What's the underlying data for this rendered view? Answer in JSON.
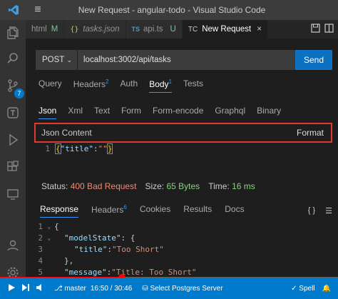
{
  "window": {
    "title": "New Request - angular-todo - Visual Studio Code"
  },
  "activity": {
    "source_control_badge": "7"
  },
  "tabs": [
    {
      "label": "html",
      "modifier": "M"
    },
    {
      "label": "tasks.json"
    },
    {
      "label": "api.ts",
      "modifier": "U"
    },
    {
      "label": "New Request",
      "close": "×"
    }
  ],
  "request": {
    "method": "POST",
    "url": "localhost:3002/api/tasks",
    "send_label": "Send",
    "tabs": [
      {
        "label": "Query"
      },
      {
        "label": "Headers",
        "count": "2"
      },
      {
        "label": "Auth"
      },
      {
        "label": "Body",
        "count": "1",
        "active": true
      },
      {
        "label": "Tests"
      }
    ],
    "body_types": [
      "Json",
      "Xml",
      "Text",
      "Form",
      "Form-encode",
      "Graphql",
      "Binary"
    ],
    "json_content_label": "Json Content",
    "format_label": "Format",
    "editor": {
      "line": "1",
      "key": "\"title\"",
      "value": "\"\""
    }
  },
  "response": {
    "status_label": "Status:",
    "status_value": "400 Bad Request",
    "size_label": "Size:",
    "size_value": "65 Bytes",
    "time_label": "Time:",
    "time_value": "16 ms",
    "tabs": [
      {
        "label": "Response",
        "active": true
      },
      {
        "label": "Headers",
        "count": "6"
      },
      {
        "label": "Cookies"
      },
      {
        "label": "Results"
      },
      {
        "label": "Docs"
      }
    ],
    "actions": [
      "{ }",
      "☰"
    ],
    "lines": [
      {
        "n": "1",
        "text": "{"
      },
      {
        "n": "2",
        "key": "\"modelState\"",
        "rest": ": {"
      },
      {
        "n": "3",
        "key": "\"title\"",
        "val": "\"Too Short\""
      },
      {
        "n": "4",
        "text": "},"
      },
      {
        "n": "5",
        "key": "\"message\"",
        "val": "\"Title: Too Short\""
      }
    ]
  },
  "statusbar": {
    "branch": "master",
    "time": "16:50 / 30:46",
    "postgres": "Select Postgres Server",
    "spell": "Spell"
  },
  "video": {
    "progress_fraction": 0.36
  },
  "colors": {
    "accent": "#007acc",
    "highlight_border": "#e23a2a",
    "bad": "#f48771",
    "ok": "#89d185"
  }
}
